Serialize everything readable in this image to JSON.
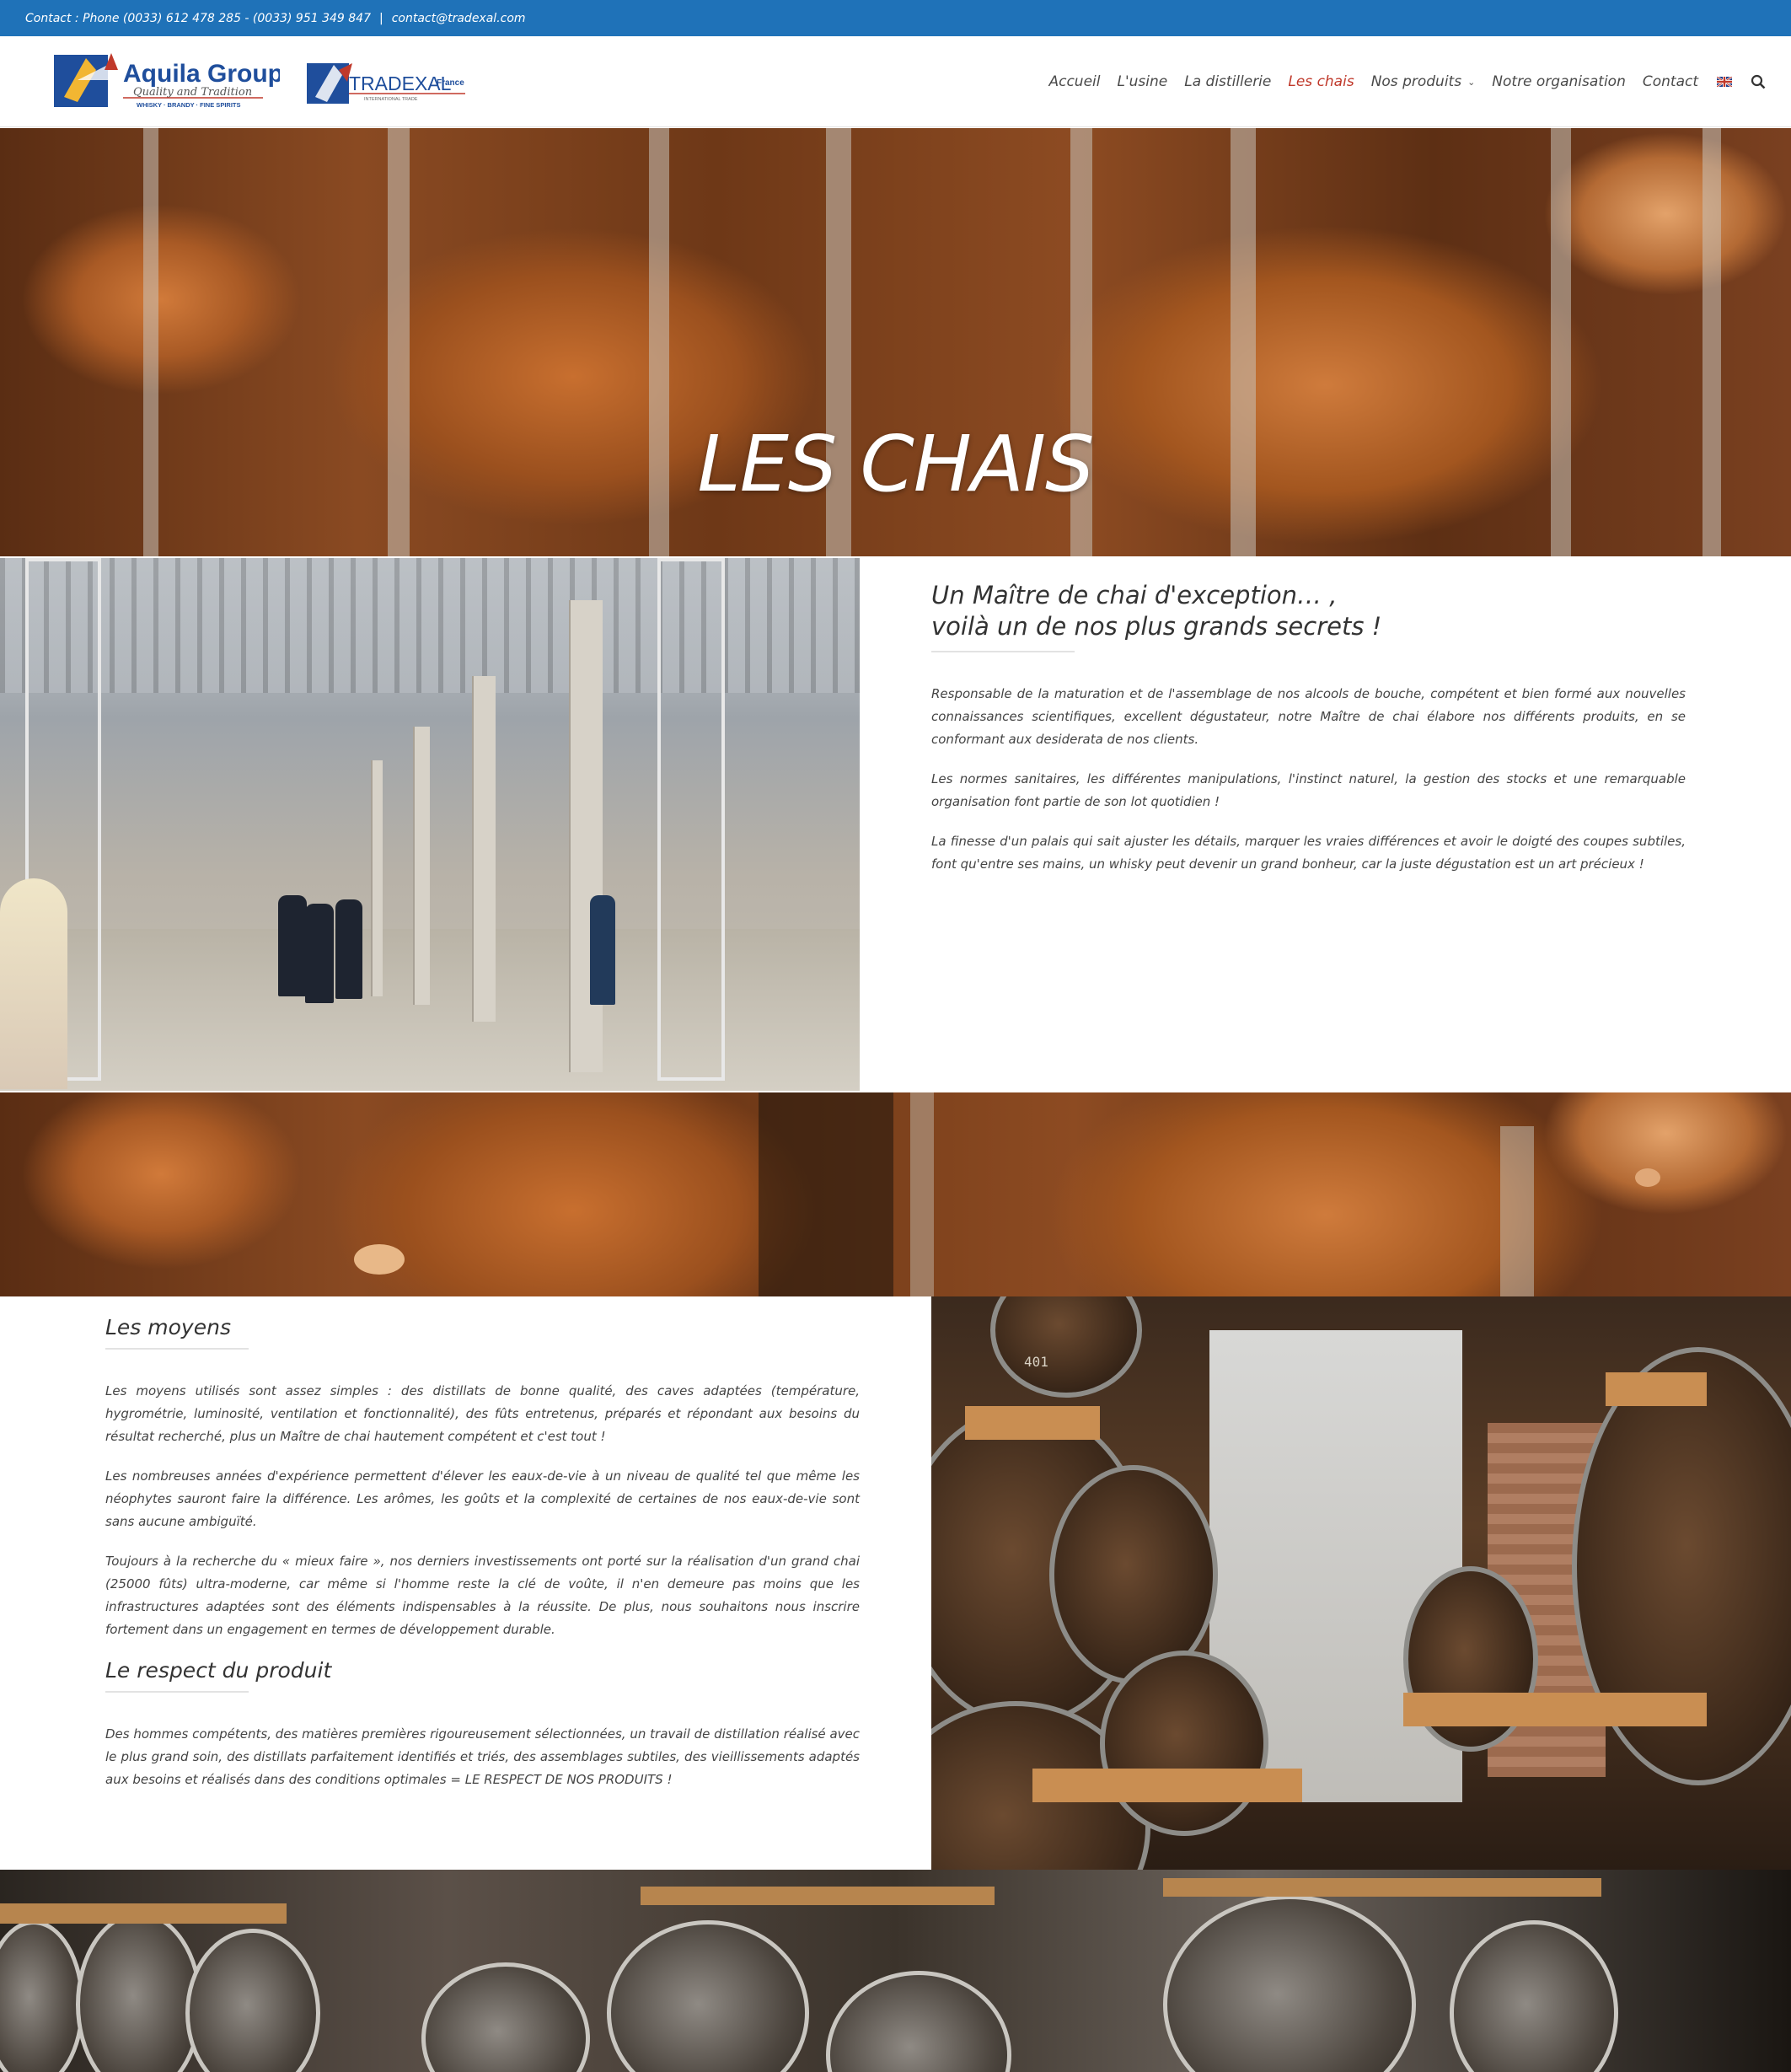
{
  "topbar": {
    "contact": "Contact : Phone (0033) 612 478 285 - (0033) 951 349 847",
    "separator": "|",
    "email": "contact@tradexal.com"
  },
  "header": {
    "logo_aquila_name": "Aquila Group",
    "logo_aquila_tagline": "Quality and Tradition",
    "logo_aquila_sub": "WHISKY · BRANDY · FINE SPIRITS",
    "logo_tradexal_name": "TRADEXAL",
    "logo_tradexal_country": "France",
    "logo_tradexal_sub": "INTERNATIONAL TRADE"
  },
  "nav": {
    "items": [
      {
        "label": "Accueil",
        "active": false
      },
      {
        "label": "L'usine",
        "active": false
      },
      {
        "label": "La distillerie",
        "active": false
      },
      {
        "label": "Les chais",
        "active": true
      },
      {
        "label": "Nos produits",
        "active": false,
        "has_dropdown": true
      },
      {
        "label": "Notre organisation",
        "active": false
      },
      {
        "label": "Contact",
        "active": false
      }
    ],
    "flag_icon": "uk-flag-icon",
    "search_icon": "search-icon",
    "active_color": "#c0392b"
  },
  "hero": {
    "title": "LES CHAIS"
  },
  "maitre": {
    "heading_line1": "Un Maître de chai d'exception… ,",
    "heading_line2": "voilà un de nos plus grands secrets !",
    "paragraphs": [
      "Responsable de la maturation et de l'assemblage de nos alcools de bouche, compétent et bien formé aux nouvelles connaissances scientifiques, excellent dégustateur, notre Maître de chai élabore nos différents produits, en se conformant aux desiderata de nos clients.",
      "Les normes sanitaires, les différentes manipulations, l'instinct naturel, la gestion des stocks et une remarquable organisation font partie de son lot quotidien !",
      "La finesse d'un palais qui sait ajuster les détails, marquer les vraies différences et avoir le doigté des coupes subtiles, font qu'entre ses mains, un whisky peut devenir un grand bonheur, car la juste dégustation est un art précieux !"
    ]
  },
  "moyens": {
    "heading": "Les moyens",
    "paragraphs": [
      "Les moyens utilisés sont assez simples : des distillats de bonne qualité, des caves adaptées (température, hygrométrie, luminosité, ventilation et fonctionnalité), des fûts entretenus, préparés et répondant aux besoins du résultat recherché, plus un Maître de chai hautement compétent et c'est tout !",
      "Les nombreuses années d'expérience permettent d'élever les eaux-de-vie à un niveau de qualité tel que même les néophytes sauront faire la différence. Les arômes, les goûts et la complexité de certaines de nos eaux-de-vie sont sans aucune ambiguïté.",
      "Toujours à la recherche du « mieux faire », nos derniers investissements ont porté sur la réalisation d'un grand chai (25000 fûts) ultra-moderne, car même si l'homme reste la clé de voûte, il n'en demeure pas moins que les infrastructures adaptées sont des éléments indispensables à la réussite. De plus, nous souhaitons nous inscrire fortement dans un engagement en termes de développement durable."
    ]
  },
  "respect": {
    "heading": "Le respect du produit",
    "paragraphs": [
      "Des hommes compétents, des matières premières rigoureusement sélectionnées, un travail de distillation réalisé avec le plus grand soin, des distillats parfaitement identifiés et triés, des assemblages subtiles, des vieillissements adaptés aux besoins et réalisés dans des conditions optimales = LE RESPECT DE NOS PRODUITS !"
    ]
  },
  "cellar": {
    "cask_label": "401"
  }
}
